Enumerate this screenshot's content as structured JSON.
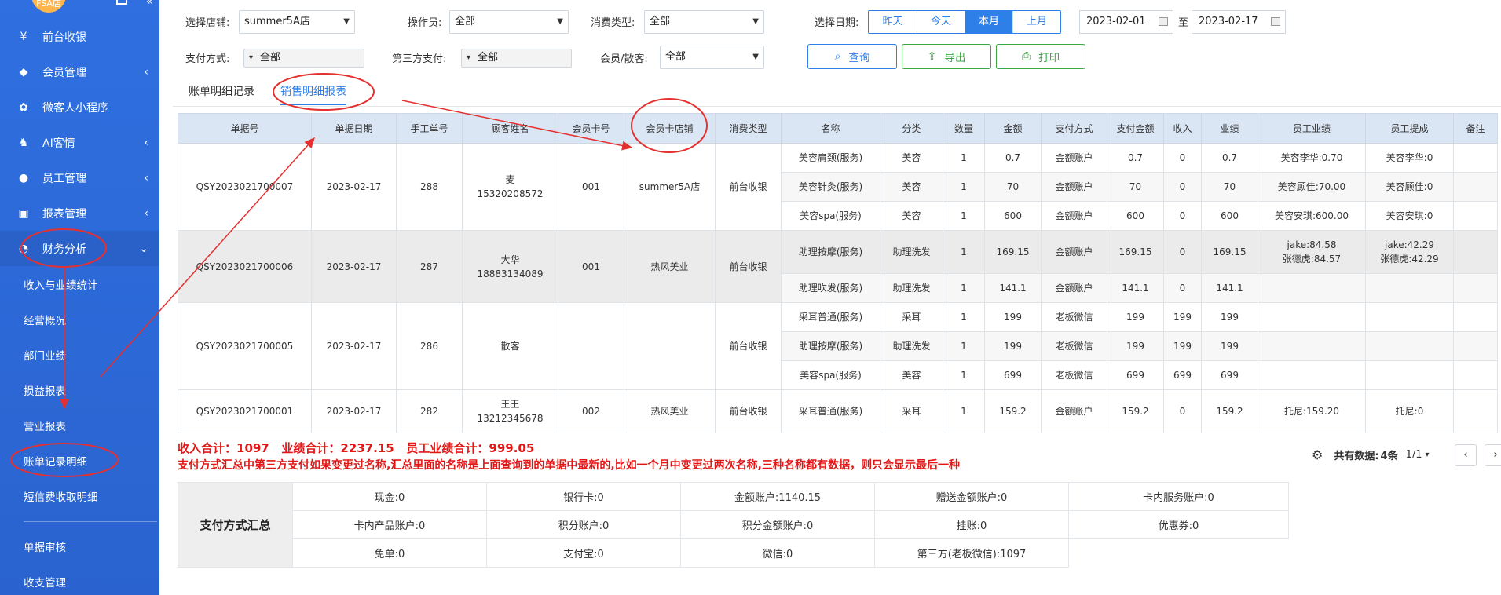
{
  "sidebar": {
    "store_badge": "FSA店",
    "items": [
      {
        "label": "前台收银",
        "icon": "cashier-icon",
        "chevron": ""
      },
      {
        "label": "会员管理",
        "icon": "diamond-icon",
        "chevron": "‹"
      },
      {
        "label": "微客人小程序",
        "icon": "miniprogram-icon",
        "chevron": ""
      },
      {
        "label": "AI客情",
        "icon": "ai-customer-icon",
        "chevron": "‹"
      },
      {
        "label": "员工管理",
        "icon": "staff-icon",
        "chevron": "‹"
      },
      {
        "label": "报表管理",
        "icon": "report-icon",
        "chevron": "‹"
      },
      {
        "label": "财务分析",
        "icon": "pie-chart-icon",
        "chevron": "⌄"
      }
    ],
    "sub_items": [
      "收入与业绩统计",
      "经营概况",
      "部门业绩",
      "损益报表",
      "营业报表",
      "账单记录明细",
      "短信费收取明细"
    ],
    "sub_items2": [
      "单据审核",
      "收支管理"
    ]
  },
  "filters": {
    "store_label": "选择店铺:",
    "store_value": "summer5A店",
    "operator_label": "操作员:",
    "operator_value": "全部",
    "consume_type_label": "消费类型:",
    "consume_type_value": "全部",
    "date_label": "选择日期:",
    "date_options": [
      "昨天",
      "今天",
      "本月",
      "上月"
    ],
    "date_from": "2023-02-01",
    "date_to_label": "至",
    "date_to": "2023-02-17",
    "pay_method_label": "支付方式:",
    "pay_method_value": "全部",
    "third_pay_label": "第三方支付:",
    "third_pay_value": "全部",
    "member_label": "会员/散客:",
    "member_value": "全部"
  },
  "buttons": {
    "query": "查询",
    "export": "导出",
    "print": "打印"
  },
  "tabs": [
    "账单明细记录",
    "销售明细报表"
  ],
  "table": {
    "headers": [
      "单据号",
      "单据日期",
      "手工单号",
      "顾客姓名",
      "会员卡号",
      "会员卡店铺",
      "消费类型",
      "名称",
      "分类",
      "数量",
      "金额",
      "支付方式",
      "支付金额",
      "收入",
      "业绩",
      "员工业绩",
      "员工提成",
      "备注"
    ],
    "groups": [
      {
        "order_no": "QSY2023021700007",
        "date": "2023-02-17",
        "manual_no": "288",
        "customer": "麦",
        "phone": "15320208572",
        "card_no": "001",
        "card_store": "summer5A店",
        "type": "前台收银",
        "items": [
          {
            "name": "美容肩颈(服务)",
            "category": "美容",
            "qty": "1",
            "amount": "0.7",
            "pay": "金额账户",
            "pay_amount": "0.7",
            "income": "0",
            "perf": "0.7",
            "staff_perf": [
              "美容李华:0.70"
            ],
            "staff_comm": [
              "美容李华:0"
            ]
          },
          {
            "name": "美容针灸(服务)",
            "category": "美容",
            "qty": "1",
            "amount": "70",
            "pay": "金额账户",
            "pay_amount": "70",
            "income": "0",
            "perf": "70",
            "staff_perf": [
              "美容顾佳:70.00"
            ],
            "staff_comm": [
              "美容顾佳:0"
            ]
          },
          {
            "name": "美容spa(服务)",
            "category": "美容",
            "qty": "1",
            "amount": "600",
            "pay": "金额账户",
            "pay_amount": "600",
            "income": "0",
            "perf": "600",
            "staff_perf": [
              "美容安琪:600.00"
            ],
            "staff_comm": [
              "美容安琪:0"
            ]
          }
        ]
      },
      {
        "order_no": "QSY2023021700006",
        "date": "2023-02-17",
        "manual_no": "287",
        "customer": "大华",
        "phone": "18883134089",
        "card_no": "001",
        "card_store": "热风美业",
        "type": "前台收银",
        "items": [
          {
            "name": "助理按摩(服务)",
            "category": "助理洗发",
            "qty": "1",
            "amount": "169.15",
            "pay": "金额账户",
            "pay_amount": "169.15",
            "income": "0",
            "perf": "169.15",
            "staff_perf": [
              "jake:84.58",
              "张德虎:84.57"
            ],
            "staff_comm": [
              "jake:42.29",
              "张德虎:42.29"
            ]
          },
          {
            "name": "助理吹发(服务)",
            "category": "助理洗发",
            "qty": "1",
            "amount": "141.1",
            "pay": "金额账户",
            "pay_amount": "141.1",
            "income": "0",
            "perf": "141.1",
            "staff_perf": [],
            "staff_comm": []
          }
        ]
      },
      {
        "order_no": "QSY2023021700005",
        "date": "2023-02-17",
        "manual_no": "286",
        "customer": "散客",
        "phone": "",
        "card_no": "",
        "card_store": "",
        "type": "前台收银",
        "items": [
          {
            "name": "采耳普通(服务)",
            "category": "采耳",
            "qty": "1",
            "amount": "199",
            "pay": "老板微信",
            "pay_amount": "199",
            "income": "199",
            "perf": "199",
            "staff_perf": [],
            "staff_comm": []
          },
          {
            "name": "助理按摩(服务)",
            "category": "助理洗发",
            "qty": "1",
            "amount": "199",
            "pay": "老板微信",
            "pay_amount": "199",
            "income": "199",
            "perf": "199",
            "staff_perf": [],
            "staff_comm": []
          },
          {
            "name": "美容spa(服务)",
            "category": "美容",
            "qty": "1",
            "amount": "699",
            "pay": "老板微信",
            "pay_amount": "699",
            "income": "699",
            "perf": "699",
            "staff_perf": [],
            "staff_comm": []
          }
        ]
      },
      {
        "order_no": "QSY2023021700001",
        "date": "2023-02-17",
        "manual_no": "282",
        "customer": "王王",
        "phone": "13212345678",
        "card_no": "002",
        "card_store": "热风美业",
        "type": "前台收银",
        "items": [
          {
            "name": "采耳普通(服务)",
            "category": "采耳",
            "qty": "1",
            "amount": "159.2",
            "pay": "金额账户",
            "pay_amount": "159.2",
            "income": "0",
            "perf": "159.2",
            "staff_perf": [
              "托尼:159.20"
            ],
            "staff_comm": [
              "托尼:0"
            ]
          }
        ]
      }
    ]
  },
  "summary": {
    "totals": "收入合计：1097   业绩合计：2237.15   员工业绩合计：999.05",
    "note": "支付方式汇总中第三方支付如果变更过名称,汇总里面的名称是上面查询到的单据中最新的,比如一个月中变更过两次名称,三种名称都有数据，则只会显示最后一种"
  },
  "pager": {
    "total_label": "共有数据:",
    "total_value": "4条",
    "page": "1/1"
  },
  "pay_summary": {
    "title": "支付方式汇总",
    "rows": [
      [
        "现金:0",
        "银行卡:0",
        "金额账户:1140.15",
        "赠送金额账户:0",
        "卡内服务账户:0"
      ],
      [
        "卡内产品账户:0",
        "积分账户:0",
        "积分金额账户:0",
        "挂账:0",
        "优惠券:0"
      ],
      [
        "免单:0",
        "支付宝:0",
        "微信:0",
        "第三方(老板微信):1097",
        ""
      ]
    ]
  },
  "colors": {
    "sidebar": "#2f6fe0",
    "accent": "#2f7fe8",
    "annotation": "#e53030",
    "summary_text": "#e21616",
    "header_bg": "#dbe6f4"
  }
}
